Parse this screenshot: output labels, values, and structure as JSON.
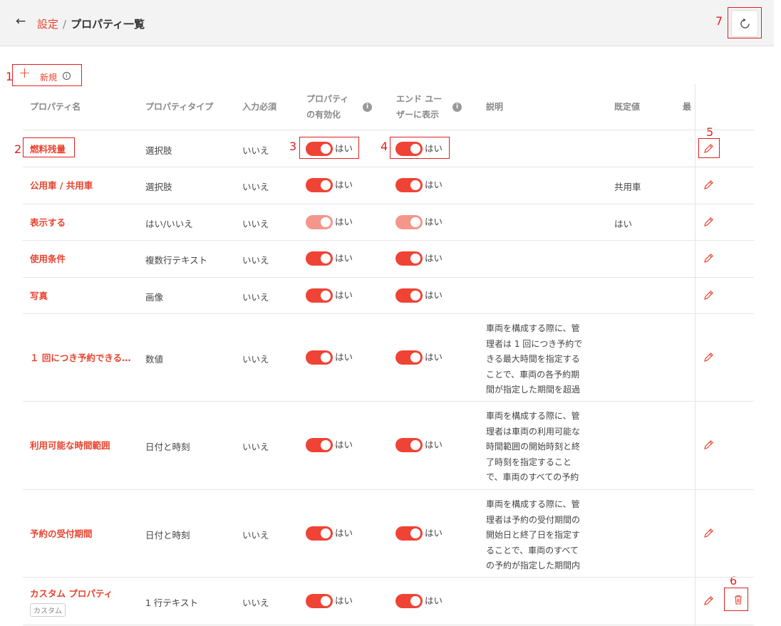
{
  "header": {
    "back_icon": "arrow-left-icon",
    "breadcrumb_link": "設定",
    "breadcrumb_sep": "/",
    "breadcrumb_current": "プロパティ一覧"
  },
  "toolbar": {
    "new_label": "新規",
    "info_icon": "info-icon"
  },
  "annotations": [
    "1",
    "2",
    "3",
    "4",
    "5",
    "6",
    "7"
  ],
  "columns": {
    "name": "プロパティ名",
    "type": "プロパティタイプ",
    "required": "入力必須",
    "enabled_l1": "プロパティ",
    "enabled_l2": "の有効化",
    "display_l1": "エンド ユー",
    "display_l2": "ザーに表示",
    "description": "説明",
    "default": "既定値",
    "cut": "最"
  },
  "rows": [
    {
      "name": "燃料残量",
      "type": "選択肢",
      "required": "いいえ",
      "enabled": "はい",
      "display": "はい",
      "description": [],
      "default": ""
    },
    {
      "name": "公用車 / 共用車",
      "type": "選択肢",
      "required": "いいえ",
      "enabled": "はい",
      "display": "はい",
      "description": [],
      "default": "共用車"
    },
    {
      "name": "表示する",
      "type": "はい/いいえ",
      "required": "いいえ",
      "enabled": "はい",
      "display": "はい",
      "description": [],
      "default": "はい"
    },
    {
      "name": "使用条件",
      "type": "複数行テキスト",
      "required": "いいえ",
      "enabled": "はい",
      "display": "はい",
      "description": [],
      "default": ""
    },
    {
      "name": "写真",
      "type": "画像",
      "required": "いいえ",
      "enabled": "はい",
      "display": "はい",
      "description": [],
      "default": ""
    },
    {
      "name": "１ 回につき予約できる…",
      "type": "数値",
      "required": "いいえ",
      "enabled": "はい",
      "display": "はい",
      "description": [
        "車両を構成する際に、管",
        "理者は 1 回につき予約で",
        "きる最大時間を指定する",
        "ことで、車両の各予約期",
        "間が指定した期間を超過"
      ],
      "default": ""
    },
    {
      "name": "利用可能な時間範囲",
      "type": "日付と時刻",
      "required": "いいえ",
      "enabled": "はい",
      "display": "はい",
      "description": [
        "車両を構成する際に、管",
        "理者は車両の利用可能な",
        "時間範囲の開始時刻と終",
        "了時刻を指定すること",
        "で、車両のすべての予約"
      ],
      "default": ""
    },
    {
      "name": "予約の受付期間",
      "type": "日付と時刻",
      "required": "いいえ",
      "enabled": "はい",
      "display": "はい",
      "description": [
        "車両を構成する際に、管",
        "理者は予約の受付期間の",
        "開始日と終了日を指定す",
        "ることで、車両のすべて",
        "の予約が指定した期間内"
      ],
      "default": ""
    },
    {
      "name": "カスタム プロパティ",
      "tag": "カスタム",
      "type": "1 行テキスト",
      "required": "いいえ",
      "enabled": "はい",
      "display": "はい",
      "description": [],
      "default": ""
    }
  ],
  "icons": {
    "edit": "pencil-icon",
    "delete": "trash-icon",
    "refresh": "refresh-icon"
  }
}
